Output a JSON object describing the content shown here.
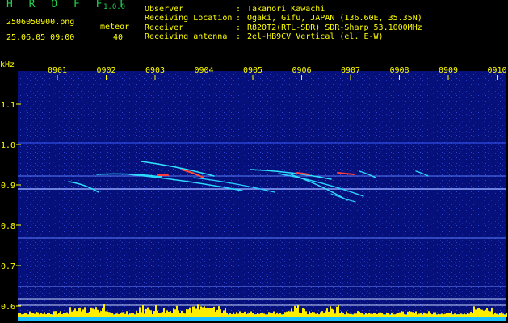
{
  "app": {
    "name": "H R O F F T",
    "version": "1.0.0",
    "filename": "2506050900.png",
    "timestamp": "25.06.05 09:00",
    "meteor_label": "meteor",
    "meteor_count": "40"
  },
  "info": [
    {
      "label": "Observer",
      "value": "Takanori Kawachi"
    },
    {
      "label": "Receiving Location",
      "value": "Ogaki, Gifu, JAPAN (136.60E, 35.35N)"
    },
    {
      "label": "Receiver",
      "value": "R820T2(RTL-SDR) SDR-Sharp 53.1000MHz"
    },
    {
      "label": "Receiving antenna",
      "value": "2el-HB9CV Vertical (el. E-W)"
    }
  ],
  "axes": {
    "y_unit": "kHz",
    "time_ticks": [
      "0901",
      "0902",
      "0903",
      "0904",
      "0905",
      "0906",
      "0907",
      "0908",
      "0909",
      "0910"
    ],
    "freq_ticks": [
      "1.1",
      "1.0",
      "0.9",
      "0.8",
      "0.7",
      "0.6"
    ]
  },
  "colors": {
    "background": "#000000",
    "plot_bg": "#06107a",
    "text": "#ffff00",
    "logo": "#1fd04a",
    "baseline": "#19c0ff",
    "signal": "#ffee00"
  }
}
